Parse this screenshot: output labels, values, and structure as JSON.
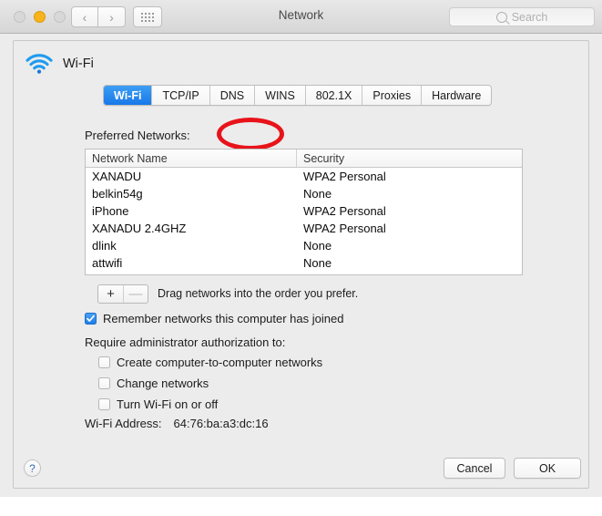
{
  "window": {
    "title": "Network",
    "traffic_lights": {
      "close": "close-button",
      "minimize": "minimize-button",
      "zoom": "zoom-button"
    },
    "nav": {
      "back": "‹",
      "forward": "›"
    },
    "search": {
      "placeholder": "Search",
      "value": ""
    }
  },
  "service": {
    "name": "Wi-Fi",
    "icon": "wifi-icon"
  },
  "tabs": [
    {
      "label": "Wi-Fi",
      "active": true
    },
    {
      "label": "TCP/IP",
      "active": false
    },
    {
      "label": "DNS",
      "active": false
    },
    {
      "label": "WINS",
      "active": false
    },
    {
      "label": "802.1X",
      "active": false
    },
    {
      "label": "Proxies",
      "active": false
    },
    {
      "label": "Hardware",
      "active": false
    }
  ],
  "annotation": {
    "shape": "ellipse",
    "color": "#e8131a",
    "target": "DNS"
  },
  "preferred_networks": {
    "label": "Preferred Networks:",
    "columns": [
      "Network Name",
      "Security"
    ],
    "rows": [
      {
        "name": "XANADU",
        "security": "WPA2 Personal"
      },
      {
        "name": "belkin54g",
        "security": "None"
      },
      {
        "name": "iPhone",
        "security": "WPA2 Personal"
      },
      {
        "name": "XANADU 2.4GHZ",
        "security": "WPA2 Personal"
      },
      {
        "name": "dlink",
        "security": "None"
      },
      {
        "name": "attwifi",
        "security": "None"
      }
    ]
  },
  "list_controls": {
    "add": "+",
    "remove": "—",
    "hint": "Drag networks into the order you prefer."
  },
  "remember_option": {
    "label": "Remember networks this computer has joined",
    "checked": true
  },
  "admin_auth": {
    "label": "Require administrator authorization to:",
    "options": [
      {
        "label": "Create computer-to-computer networks",
        "checked": false
      },
      {
        "label": "Change networks",
        "checked": false
      },
      {
        "label": "Turn Wi-Fi on or off",
        "checked": false
      }
    ]
  },
  "wifi_address": {
    "label": "Wi-Fi Address:",
    "value": "64:76:ba:a3:dc:16"
  },
  "footer": {
    "help": "?",
    "cancel": "Cancel",
    "ok": "OK"
  }
}
